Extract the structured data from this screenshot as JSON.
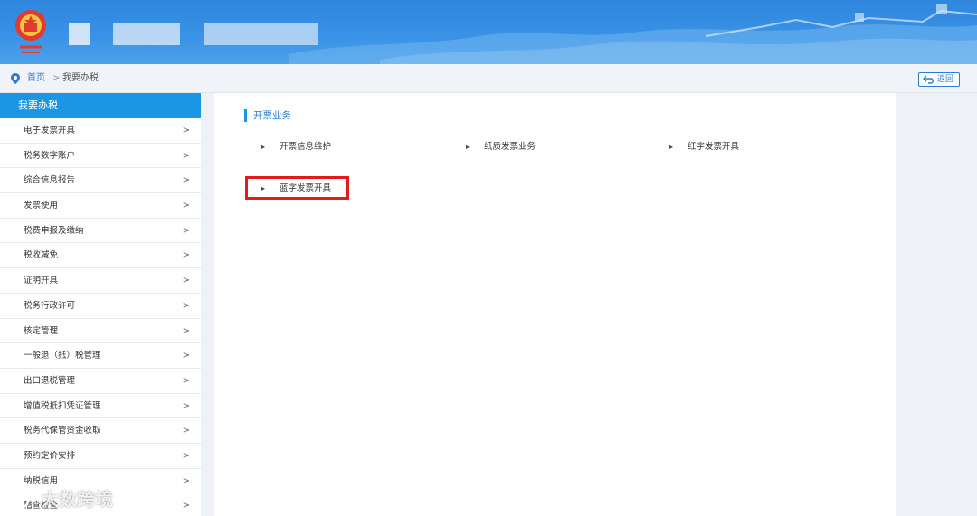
{
  "breadcrumb": {
    "home": "首页",
    "separator": ">",
    "current": "我要办税"
  },
  "back_button": {
    "label": "返回",
    "icon": "back-arrow-icon"
  },
  "sidebar": {
    "title": "我要办税",
    "items": [
      {
        "label": "电子发票开具"
      },
      {
        "label": "税务数字账户"
      },
      {
        "label": "综合信息报告"
      },
      {
        "label": "发票使用"
      },
      {
        "label": "税费申报及缴纳"
      },
      {
        "label": "税收减免"
      },
      {
        "label": "证明开具"
      },
      {
        "label": "税务行政许可"
      },
      {
        "label": "核定管理"
      },
      {
        "label": "一般退（抵）税管理"
      },
      {
        "label": "出口退税管理"
      },
      {
        "label": "增值税抵扣凭证管理"
      },
      {
        "label": "税务代保管资金收取"
      },
      {
        "label": "预约定价安排"
      },
      {
        "label": "纳税信用"
      },
      {
        "label": "稽查检查"
      }
    ],
    "chevron": ">"
  },
  "main": {
    "section_title": "开票业务",
    "links": [
      {
        "label": "开票信息维护"
      },
      {
        "label": "纸质发票业务"
      },
      {
        "label": "红字发票开具"
      },
      {
        "label": "蓝字发票开具"
      }
    ],
    "bullet": "▸"
  },
  "watermark": {
    "text": "大数跨境"
  },
  "colors": {
    "header_blue": "#3a93e6",
    "accent_blue": "#1b96e4",
    "highlight_red": "#e21a1a"
  }
}
